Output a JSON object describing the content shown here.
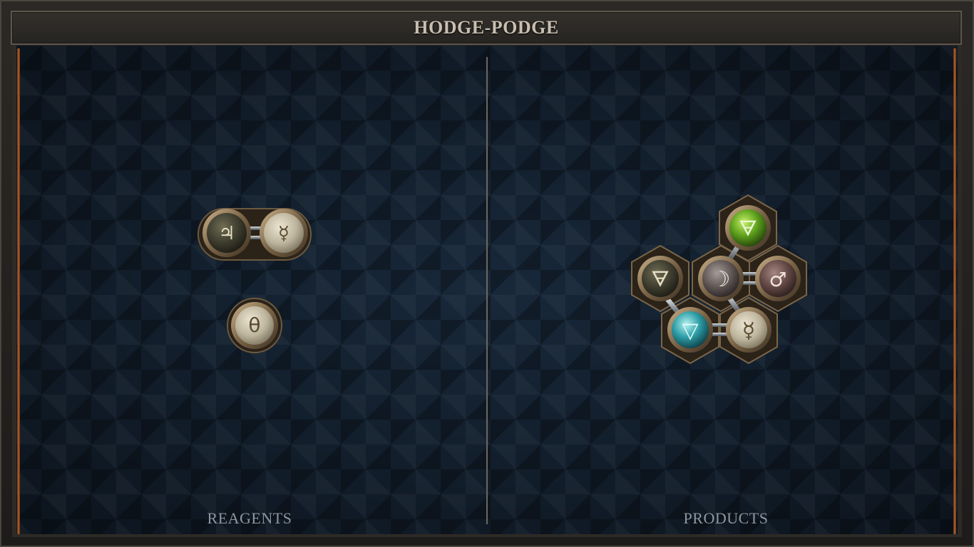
{
  "title": "HODGE-PODGE",
  "panels": {
    "reagents_label": "REAGENTS",
    "products_label": "PRODUCTS"
  },
  "reagents": [
    {
      "atoms": [
        {
          "element": "tin",
          "symbol": "♃",
          "color": "dark-olive"
        },
        {
          "element": "quicksilver",
          "symbol": "☿",
          "color": "ivory"
        }
      ],
      "bonds": [
        [
          0,
          1
        ]
      ]
    },
    {
      "atoms": [
        {
          "element": "salt",
          "symbol": "θ",
          "color": "ivory"
        }
      ],
      "bonds": []
    }
  ],
  "products": [
    {
      "atoms": [
        {
          "element": "earth",
          "symbol": "🜃",
          "color": "green"
        },
        {
          "element": "fire",
          "symbol": "🜃",
          "color": "dark-olive"
        },
        {
          "element": "silver",
          "symbol": "☽",
          "color": "grey"
        },
        {
          "element": "iron",
          "symbol": "♂",
          "color": "mauve"
        },
        {
          "element": "water",
          "symbol": "▽",
          "color": "teal"
        },
        {
          "element": "quicksilver",
          "symbol": "☿",
          "color": "ivory"
        }
      ],
      "bonds": [
        [
          0,
          2
        ],
        [
          2,
          3
        ],
        [
          1,
          4
        ],
        [
          2,
          5
        ],
        [
          4,
          5
        ]
      ]
    }
  ],
  "colors": {
    "background": "#101a25",
    "frame": "#2b2825",
    "copper_trim": "#b8642c",
    "title_text": "#c9bfb0",
    "label_text": "#8c97a0"
  }
}
